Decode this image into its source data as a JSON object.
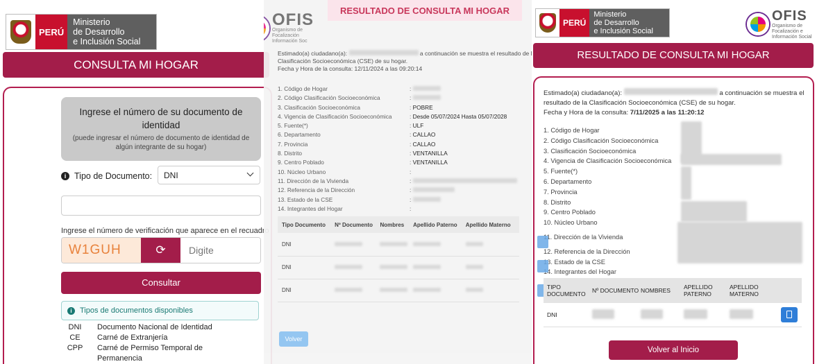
{
  "left": {
    "logo": {
      "peru": "PERÚ",
      "ministry": "Ministerio\nde Desarrollo\ne Inclusión Social"
    },
    "banner": "CONSULTA MI HOGAR",
    "prompt_title": "Ingrese el número de su documento de identidad",
    "prompt_sub": "(puede ingresar el número de documento de identidad de algún integrante de su hogar)",
    "doc_type_label": "Tipo de Documento:",
    "doc_type_value": "DNI",
    "doc_number_value": "",
    "captcha_label": "Ingrese el número de verificación que aparece en el recuadro",
    "captcha_code": "W1GUH",
    "captcha_placeholder": "Digite",
    "submit": "Consultar",
    "doc_types_title": "Tipos de documentos disponibles",
    "doc_types": [
      {
        "code": "DNI",
        "name": "Documento Nacional de Identidad"
      },
      {
        "code": "CE",
        "name": "Carné de Extranjería"
      },
      {
        "code": "CPP",
        "name": "Carné de Permiso Temporal de Permanencia"
      }
    ]
  },
  "mid": {
    "ofis": {
      "name": "OFIS",
      "sub": "Organismo de Focalización Información Soc"
    },
    "banner": "RESULTADO DE CONSULTA MI HOGAR",
    "intro_a": "Estimado(a) ciudadano(a):",
    "intro_b": "a continuación se muestra el resultado de la Clasificación Socioeconómica (CSE) de su hogar.",
    "datetime": "Fecha y Hora de la consulta: 12/11/2024 a las 09:20:14",
    "fields": [
      {
        "label": "1. Código de Hogar",
        "value": ""
      },
      {
        "label": "2. Código Clasificación Socioeconómica",
        "value": ""
      },
      {
        "label": "3. Clasificación Socioeconómica",
        "value": "POBRE"
      },
      {
        "label": "4. Vigencia de Clasificación Socioeconómica",
        "value": "Desde 05/07/2024 Hasta 05/07/2028"
      },
      {
        "label": "5. Fuente(*)",
        "value": "ULF"
      },
      {
        "label": "6. Departamento",
        "value": "CALLAO"
      },
      {
        "label": "7. Provincia",
        "value": "CALLAO"
      },
      {
        "label": "8. Distrito",
        "value": "VENTANILLA"
      },
      {
        "label": "9. Centro Poblado",
        "value": "VENTANILLA"
      },
      {
        "label": "10. Núcleo Urbano",
        "value": ""
      },
      {
        "label": "11. Dirección de la Vivienda",
        "value": ""
      },
      {
        "label": "12. Referencia de la Dirección",
        "value": ""
      },
      {
        "label": "13. Estado de la CSE",
        "value": ""
      },
      {
        "label": "14. Integrantes del Hogar",
        "value": ""
      }
    ],
    "table_headers": [
      "Tipo Documento",
      "Nº Documento",
      "Nombres",
      "Apellido Paterno",
      "Apellido Materno"
    ],
    "table_rows": [
      "DNI",
      "DNI",
      "DNI"
    ],
    "back": "Volver"
  },
  "right": {
    "logo": {
      "peru": "PERÚ",
      "ministry": "Ministerio\nde Desarrollo\ne Inclusión Social"
    },
    "ofis": {
      "name": "OFIS",
      "sub": "Organismo de Focalización e Información Social"
    },
    "banner": "RESULTADO DE CONSULTA MI HOGAR",
    "intro_a": "Estimado(a) ciudadano(a):",
    "intro_b": "a continuación se muestra el resultado de la Clasificación Socioeconómica (CSE) de su hogar.",
    "datetime_label": "Fecha y Hora de la consulta:",
    "datetime_value": "7/11/2025 a las 11:20:12",
    "fields": [
      "1. Código de Hogar",
      "2. Código Clasificación Socioeconómica",
      "3. Clasificación Socioeconómica",
      "4. Vigencia de Clasificación Socioeconómica",
      "5. Fuente(*)",
      "6. Departamento",
      "7. Provincia",
      "8. Distrito",
      "9. Centro Poblado",
      "10. Núcleo Urbano",
      "11. Dirección de la Vivienda",
      "12. Referencia de la Dirección",
      "13. Estado de la CSE",
      "14. Integrantes del Hogar"
    ],
    "table_headers": [
      "TIPO DOCUMENTO",
      "Nº DOCUMENTO",
      "NOMBRES",
      "APELLIDO PATERNO",
      "APELLIDO MATERNO"
    ],
    "table_rows": [
      "DNI"
    ],
    "back": "Volver al Inicio"
  },
  "colors": {
    "brand": "#a31d4a",
    "peru_red": "#c8102e",
    "accent_blue": "#2f7ed8",
    "info_teal": "#1a7a74"
  }
}
